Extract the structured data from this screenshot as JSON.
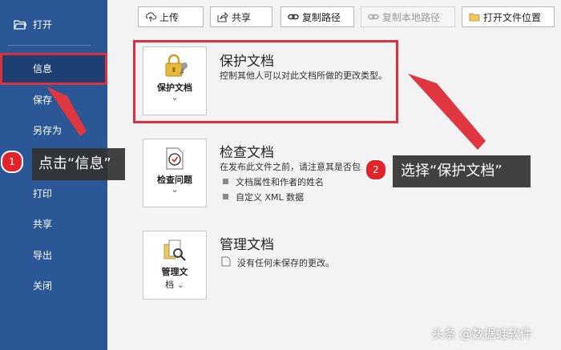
{
  "sidebar": {
    "items": [
      {
        "label": "打开"
      },
      {
        "label": "信息"
      },
      {
        "label": "保存"
      },
      {
        "label": "另存为"
      },
      {
        "label": "打印"
      },
      {
        "label": "共享"
      },
      {
        "label": "导出"
      },
      {
        "label": "关闭"
      }
    ]
  },
  "toolbar": {
    "upload": "上传",
    "share": "共享",
    "copy_path": "复制路径",
    "copy_local_path": "复制本地路径",
    "open_location": "打开文件位置"
  },
  "sections": {
    "protect": {
      "button_label": "保护文档",
      "title": "保护文档",
      "desc": "控制其他人可以对此文档所做的更改类型。"
    },
    "inspect": {
      "button_label": "检查问题",
      "title": "检查文档",
      "desc": "在发布此文件之前，请注意其是否包",
      "bullets": [
        "文档属性和作者的姓名",
        "自定义 XML 数据"
      ]
    },
    "manage": {
      "button_label_1": "管理文",
      "button_label_2": "档",
      "title": "管理文档",
      "desc": "没有任何未保存的更改。"
    }
  },
  "annotations": {
    "step1_num": "1",
    "step1_text": "点击“信息”",
    "step2_num": "2",
    "step2_text": "选择“保护文档”"
  },
  "watermark": "头条 @数据蛙软件",
  "colors": {
    "sidebar_bg": "#2b5797",
    "sidebar_active": "#1e3f72",
    "highlight_red": "#d8323f",
    "badge_red": "#e2232a",
    "callout_bg": "#323232"
  }
}
